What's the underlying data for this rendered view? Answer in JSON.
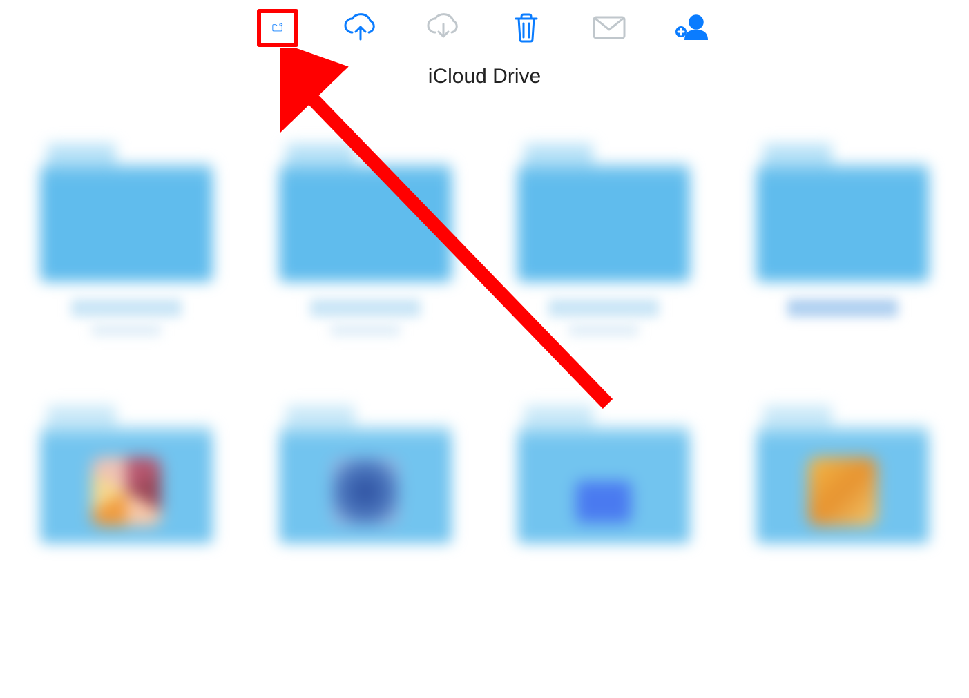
{
  "toolbar": {
    "new_folder": {
      "name": "new-folder-button",
      "highlighted": true,
      "enabled": true
    },
    "upload": {
      "name": "upload-button",
      "highlighted": false,
      "enabled": true
    },
    "download": {
      "name": "download-button",
      "highlighted": false,
      "enabled": false
    },
    "delete": {
      "name": "delete-button",
      "highlighted": false,
      "enabled": true
    },
    "email": {
      "name": "email-button",
      "highlighted": false,
      "enabled": false
    },
    "share": {
      "name": "share-button",
      "highlighted": false,
      "enabled": true
    }
  },
  "header": {
    "title": "iCloud Drive"
  },
  "items": [
    {
      "kind": "folder",
      "row": 1,
      "label_obscured": true
    },
    {
      "kind": "folder",
      "row": 1,
      "label_obscured": true
    },
    {
      "kind": "folder",
      "row": 1,
      "label_obscured": true
    },
    {
      "kind": "folder",
      "row": 1,
      "label_obscured": true,
      "label_style": "alt"
    },
    {
      "kind": "app-folder",
      "row": 2,
      "badge": "a",
      "label_obscured": true
    },
    {
      "kind": "app-folder",
      "row": 2,
      "badge": "b",
      "label_obscured": true
    },
    {
      "kind": "app-folder",
      "row": 2,
      "badge": "c",
      "label_obscured": true
    },
    {
      "kind": "app-folder",
      "row": 2,
      "badge": "d",
      "label_obscured": true
    }
  ],
  "annotation": {
    "type": "arrow",
    "color": "#ff0000",
    "points_to": "new-folder-button"
  }
}
